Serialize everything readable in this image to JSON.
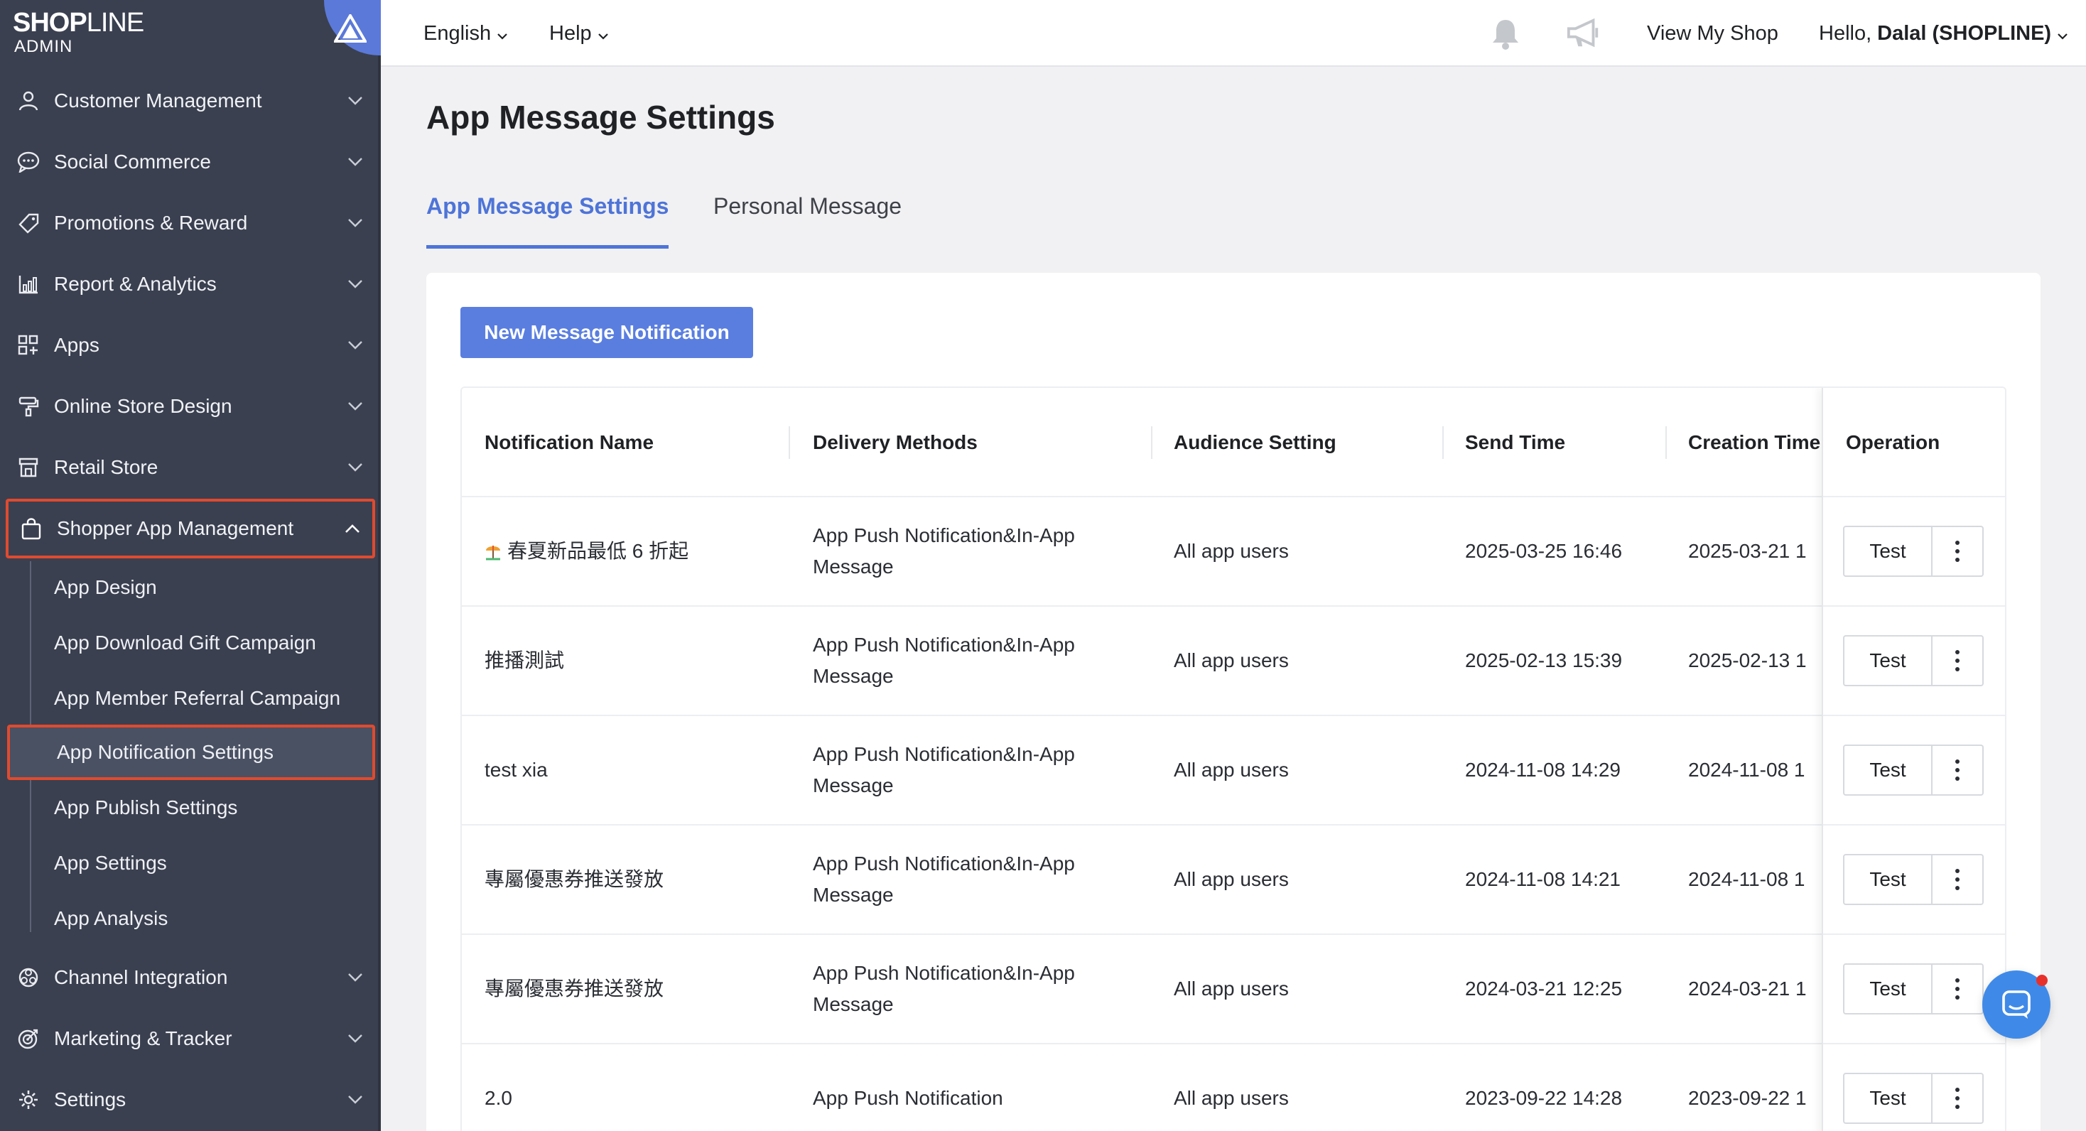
{
  "brand": {
    "logo_main": "SHOP",
    "logo_thin": "LINE",
    "logo_sub": "ADMIN"
  },
  "sidebar": {
    "items": [
      {
        "label": "Customer Management",
        "icon": "user-icon"
      },
      {
        "label": "Social Commerce",
        "icon": "chat-icon"
      },
      {
        "label": "Promotions & Reward",
        "icon": "tag-icon"
      },
      {
        "label": "Report & Analytics",
        "icon": "chart-icon"
      },
      {
        "label": "Apps",
        "icon": "apps-grid-icon"
      },
      {
        "label": "Online Store Design",
        "icon": "paint-roller-icon"
      },
      {
        "label": "Retail Store",
        "icon": "store-icon"
      },
      {
        "label": "Shopper App Management",
        "icon": "shopping-bag-icon"
      },
      {
        "label": "Channel Integration",
        "icon": "network-icon"
      },
      {
        "label": "Marketing & Tracker",
        "icon": "target-icon"
      },
      {
        "label": "Settings",
        "icon": "gear-icon"
      }
    ],
    "subitems": [
      "App Design",
      "App Download Gift Campaign",
      "App Member Referral Campaign",
      "App Notification Settings",
      "App Publish Settings",
      "App Settings",
      "App Analysis"
    ]
  },
  "topbar": {
    "language": "English",
    "help": "Help",
    "view_shop": "View My Shop",
    "greeting": "Hello,",
    "user": "Dalal (SHOPLINE)"
  },
  "main": {
    "title": "App Message Settings",
    "tabs": [
      "App Message Settings",
      "Personal Message"
    ],
    "new_button": "New Message Notification",
    "columns": [
      "Notification Name",
      "Delivery Methods",
      "Audience Setting",
      "Send Time",
      "Creation Time",
      "Operation"
    ],
    "rows": [
      {
        "name": "春夏新品最低 6 折起",
        "delivery": "App Push Notification&In-App",
        "delivery2": "Message",
        "audience": "All app users",
        "send": "2025-03-25 16:46",
        "created": "2025-03-21 1"
      },
      {
        "name": "推播測試",
        "delivery": "App Push Notification&In-App",
        "delivery2": "Message",
        "audience": "All app users",
        "send": "2025-02-13 15:39",
        "created": "2025-02-13 1"
      },
      {
        "name": "test xia",
        "delivery": "App Push Notification&In-App",
        "delivery2": "Message",
        "audience": "All app users",
        "send": "2024-11-08 14:29",
        "created": "2024-11-08 1"
      },
      {
        "name": "專屬優惠券推送發放",
        "delivery": "App Push Notification&In-App",
        "delivery2": "Message",
        "audience": "All app users",
        "send": "2024-11-08 14:21",
        "created": "2024-11-08 1"
      },
      {
        "name": "專屬優惠券推送發放",
        "delivery": "App Push Notification&In-App",
        "delivery2": "Message",
        "audience": "All app users",
        "send": "2024-03-21 12:25",
        "created": "2024-03-21 1"
      },
      {
        "name": "2.0",
        "delivery": "App Push Notification",
        "delivery2": "",
        "audience": "All app users",
        "send": "2023-09-22 14:28",
        "created": "2023-09-22 1"
      }
    ],
    "test_label": "Test"
  },
  "colors": {
    "accent": "#4e74d8",
    "sidebar": "#3a4050",
    "highlight": "#e04a2f"
  }
}
